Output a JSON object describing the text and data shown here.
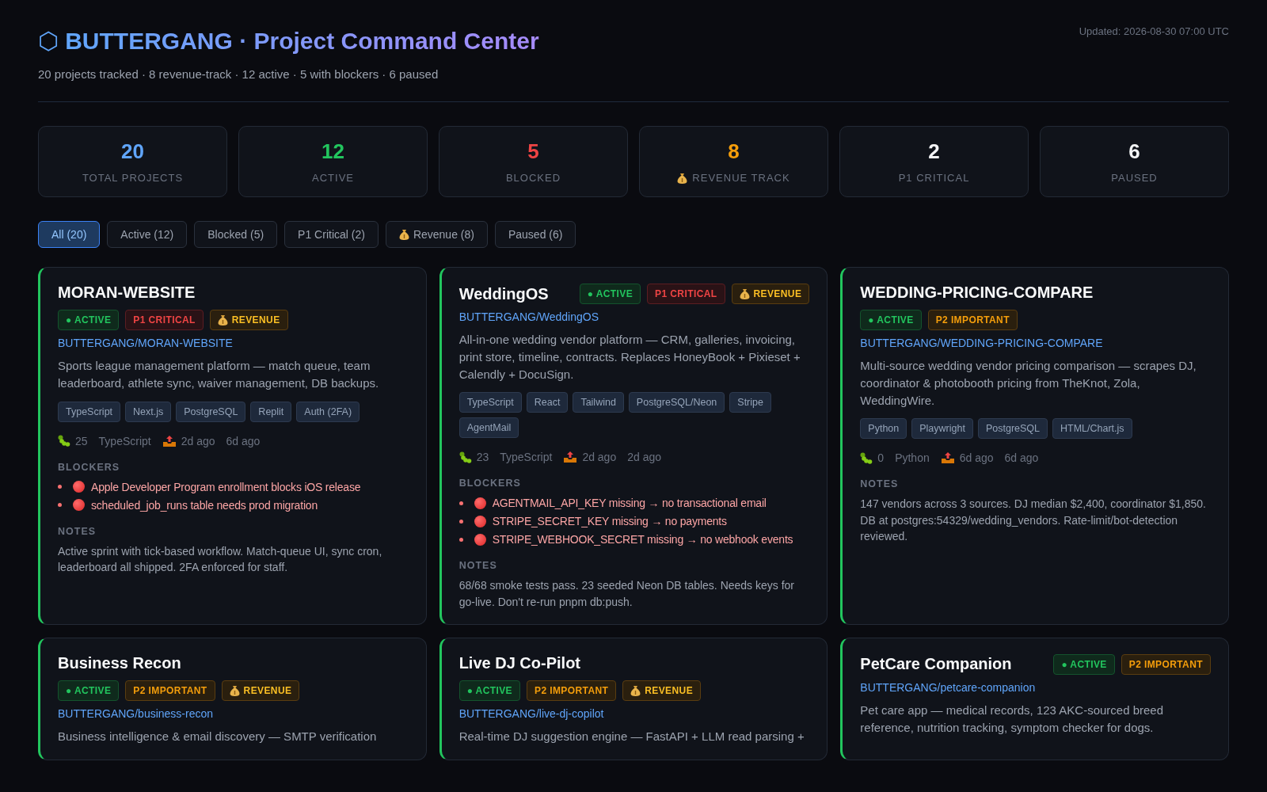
{
  "header": {
    "logo": "⬡",
    "title": "BUTTERGANG · Project Command Center",
    "subtitle": "20 projects tracked · 8 revenue-track · 12 active · 5 with blockers · 6 paused",
    "updated": "Updated: 2026-08-30 07:00 UTC"
  },
  "stats": [
    {
      "value": "20",
      "label": "TOTAL PROJECTS",
      "color": "#60a5fa"
    },
    {
      "value": "12",
      "label": "ACTIVE",
      "color": "#22c55e"
    },
    {
      "value": "5",
      "label": "BLOCKED",
      "color": "#ef4444"
    },
    {
      "value": "8",
      "label": "REVENUE TRACK",
      "color": "#f59e0b",
      "money": true
    },
    {
      "value": "2",
      "label": "P1 CRITICAL",
      "color": "#f3f4f6"
    },
    {
      "value": "6",
      "label": "PAUSED",
      "color": "#f3f4f6"
    }
  ],
  "filters": [
    {
      "label": "All (20)",
      "selected": true
    },
    {
      "label": "Active (12)",
      "selected": false
    },
    {
      "label": "Blocked (5)",
      "selected": false
    },
    {
      "label": "P1 Critical (2)",
      "selected": false
    },
    {
      "label": "Revenue (8)",
      "selected": false,
      "money": true
    },
    {
      "label": "Paused (6)",
      "selected": false
    }
  ],
  "projects": [
    {
      "name": "MORAN-WEBSITE",
      "badges": [
        {
          "kind": "active",
          "label": "● ACTIVE"
        },
        {
          "kind": "p1",
          "label": "P1 CRITICAL"
        },
        {
          "kind": "revenue",
          "label": "REVENUE"
        }
      ],
      "repo": "BUTTERGANG/MORAN-WEBSITE",
      "description": "Sports league management platform — match queue, team leaderboard, athlete sync, waiver management, DB backups.",
      "tags": [
        "TypeScript",
        "Next.js",
        "PostgreSQL",
        "Replit",
        "Auth (2FA)"
      ],
      "meta": {
        "issues": "25",
        "language": "TypeScript",
        "pushed": "2d ago",
        "updated": "6d ago"
      },
      "blockers_heading": "BLOCKERS",
      "blockers": [
        "Apple Developer Program enrollment blocks iOS release",
        "scheduled_job_runs table needs prod migration"
      ],
      "notes_heading": "NOTES",
      "notes": "Active sprint with tick-based workflow. Match-queue UI, sync cron, leaderboard all shipped. 2FA enforced for staff."
    },
    {
      "name": "WeddingOS",
      "badges": [
        {
          "kind": "active",
          "label": "● ACTIVE"
        },
        {
          "kind": "p1",
          "label": "P1 CRITICAL"
        },
        {
          "kind": "revenue",
          "label": "REVENUE"
        }
      ],
      "repo": "BUTTERGANG/WeddingOS",
      "description": "All-in-one wedding vendor platform — CRM, galleries, invoicing, print store, timeline, contracts. Replaces HoneyBook + Pixieset + Calendly + DocuSign.",
      "tags": [
        "TypeScript",
        "React",
        "Tailwind",
        "PostgreSQL/Neon",
        "Stripe",
        "AgentMail"
      ],
      "meta": {
        "issues": "23",
        "language": "TypeScript",
        "pushed": "2d ago",
        "updated": "2d ago"
      },
      "blockers_heading": "BLOCKERS",
      "blockers": [
        "AGENTMAIL_API_KEY missing → no transactional email",
        "STRIPE_SECRET_KEY missing → no payments",
        "STRIPE_WEBHOOK_SECRET missing → no webhook events"
      ],
      "notes_heading": "NOTES",
      "notes": "68/68 smoke tests pass. 23 seeded Neon DB tables. Needs keys for go-live. Don't re-run pnpm db:push."
    },
    {
      "name": "WEDDING-PRICING-COMPARE",
      "badges": [
        {
          "kind": "active",
          "label": "● ACTIVE"
        },
        {
          "kind": "p2",
          "label": "P2 IMPORTANT"
        }
      ],
      "repo": "BUTTERGANG/WEDDING-PRICING-COMPARE",
      "description": "Multi-source wedding vendor pricing comparison — scrapes DJ, coordinator & photobooth pricing from TheKnot, Zola, WeddingWire.",
      "tags": [
        "Python",
        "Playwright",
        "PostgreSQL",
        "HTML/Chart.js"
      ],
      "meta": {
        "issues": "0",
        "language": "Python",
        "pushed": "6d ago",
        "updated": "6d ago"
      },
      "notes_heading": "NOTES",
      "notes": "147 vendors across 3 sources. DJ median $2,400, coordinator $1,850. DB at postgres:54329/wedding_vendors. Rate-limit/bot-detection reviewed."
    },
    {
      "name": "Business Recon",
      "badges": [
        {
          "kind": "active",
          "label": "● ACTIVE"
        },
        {
          "kind": "p2",
          "label": "P2 IMPORTANT"
        },
        {
          "kind": "revenue",
          "label": "REVENUE"
        }
      ],
      "repo": "BUTTERGANG/business-recon",
      "description": "Business intelligence & email discovery — SMTP verification"
    },
    {
      "name": "Live DJ Co-Pilot",
      "badges": [
        {
          "kind": "active",
          "label": "● ACTIVE"
        },
        {
          "kind": "p2",
          "label": "P2 IMPORTANT"
        },
        {
          "kind": "revenue",
          "label": "REVENUE"
        }
      ],
      "repo": "BUTTERGANG/live-dj-copilot",
      "description": "Real-time DJ suggestion engine — FastAPI + LLM read parsing +"
    },
    {
      "name": "PetCare Companion",
      "badges": [
        {
          "kind": "active",
          "label": "● ACTIVE"
        },
        {
          "kind": "p2",
          "label": "P2 IMPORTANT"
        }
      ],
      "repo": "BUTTERGANG/petcare-companion",
      "description": "Pet care app — medical records, 123 AKC-sourced breed reference, nutrition tracking, symptom checker for dogs."
    }
  ]
}
